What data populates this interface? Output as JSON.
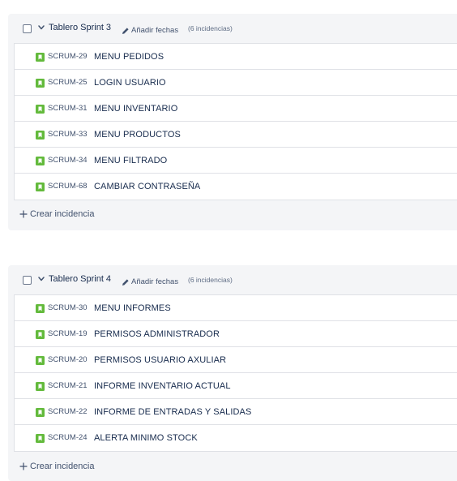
{
  "colors": {
    "story_icon": "#63ba3c",
    "panel_bg": "#f4f5f7",
    "border": "#dfe1e6",
    "text": "#172b4d"
  },
  "icons": {
    "story": "bookmark-icon",
    "expand": "chevron-down-icon",
    "edit": "pencil-icon",
    "create": "plus-icon"
  },
  "sprints": [
    {
      "name": "Tablero Sprint 3",
      "add_dates_label": "Añadir fechas",
      "issue_count": "(6 incidencias)",
      "create_label": "Crear incidencia",
      "issues": [
        {
          "key": "SCRUM-29",
          "summary": "MENU PEDIDOS"
        },
        {
          "key": "SCRUM-25",
          "summary": "LOGIN USUARIO"
        },
        {
          "key": "SCRUM-31",
          "summary": "MENU INVENTARIO"
        },
        {
          "key": "SCRUM-33",
          "summary": "MENU PRODUCTOS"
        },
        {
          "key": "SCRUM-34",
          "summary": "MENU FILTRADO"
        },
        {
          "key": "SCRUM-68",
          "summary": "CAMBIAR CONTRASEÑA"
        }
      ]
    },
    {
      "name": "Tablero Sprint 4",
      "add_dates_label": "Añadir fechas",
      "issue_count": "(6 incidencias)",
      "create_label": "Crear incidencia",
      "issues": [
        {
          "key": "SCRUM-30",
          "summary": "MENU INFORMES"
        },
        {
          "key": "SCRUM-19",
          "summary": "PERMISOS ADMINISTRADOR"
        },
        {
          "key": "SCRUM-20",
          "summary": "PERMISOS USUARIO AXULIAR"
        },
        {
          "key": "SCRUM-21",
          "summary": "INFORME INVENTARIO ACTUAL"
        },
        {
          "key": "SCRUM-22",
          "summary": "INFORME DE ENTRADAS Y SALIDAS"
        },
        {
          "key": "SCRUM-24",
          "summary": "ALERTA MINIMO STOCK"
        }
      ]
    }
  ]
}
